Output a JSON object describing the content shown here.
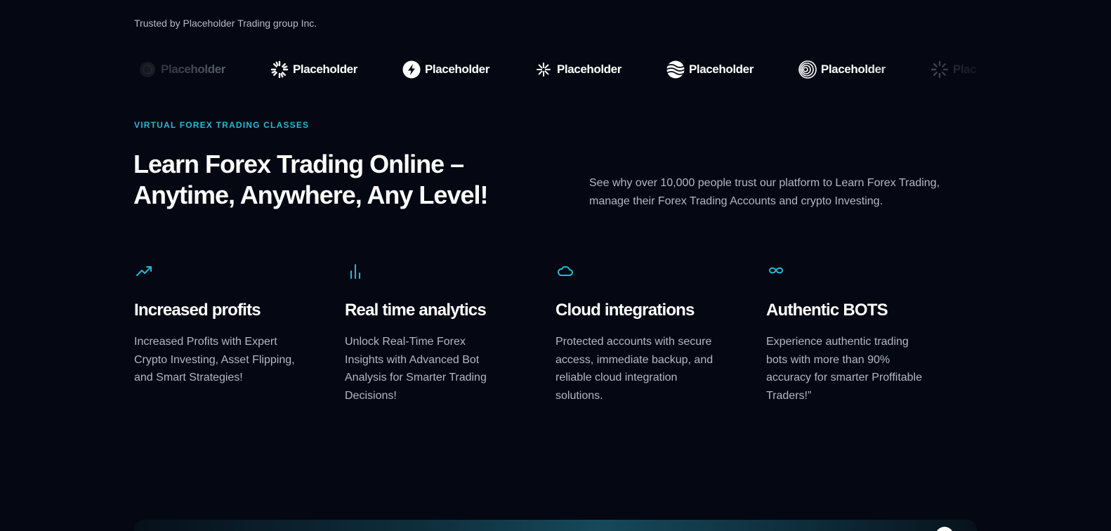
{
  "trusted_by": "Trusted by Placeholder Trading group Inc.",
  "logos": [
    {
      "icon": "ring-logo-icon",
      "label": "Placeholder"
    },
    {
      "icon": "sunburst-logo-icon",
      "label": "Placeholder"
    },
    {
      "icon": "bolt-logo-icon",
      "label": "Placeholder"
    },
    {
      "icon": "sparkle-logo-icon",
      "label": "Placeholder"
    },
    {
      "icon": "waves-logo-icon",
      "label": "Placeholder"
    },
    {
      "icon": "spiral-logo-icon",
      "label": "Placeholder"
    },
    {
      "icon": "sunburst-logo-icon",
      "label": "Placeholder"
    }
  ],
  "hero": {
    "eyebrow": "VIRTUAL FOREX TRADING CLASSES",
    "title": "Learn Forex Trading Online – Anytime, Anywhere, Any Level!",
    "subtitle": "See why over 10,000 people trust our platform to Learn Forex Trading, manage their Forex Trading Accounts and crypto Investing."
  },
  "features": [
    {
      "icon": "trending-up-icon",
      "title": "Increased profits",
      "description": "Increased Profits with Expert Crypto Investing, Asset Flipping, and Smart Strategies!"
    },
    {
      "icon": "bar-chart-icon",
      "title": "Real time analytics",
      "description": "Unlock Real-Time Forex Insights with Advanced Bot Analysis for Smarter Trading Decisions!"
    },
    {
      "icon": "cloud-icon",
      "title": "Cloud integrations",
      "description": "Protected accounts with secure access, immediate backup, and reliable cloud integration solutions."
    },
    {
      "icon": "infinity-icon",
      "title": "Authentic BOTS",
      "description": "Experience authentic trading bots with more than 90% accuracy for smarter Proffitable Traders!”"
    }
  ],
  "colors": {
    "background": "#050812",
    "accent": "#27b8d6",
    "muted_text": "#b3b8c4"
  }
}
